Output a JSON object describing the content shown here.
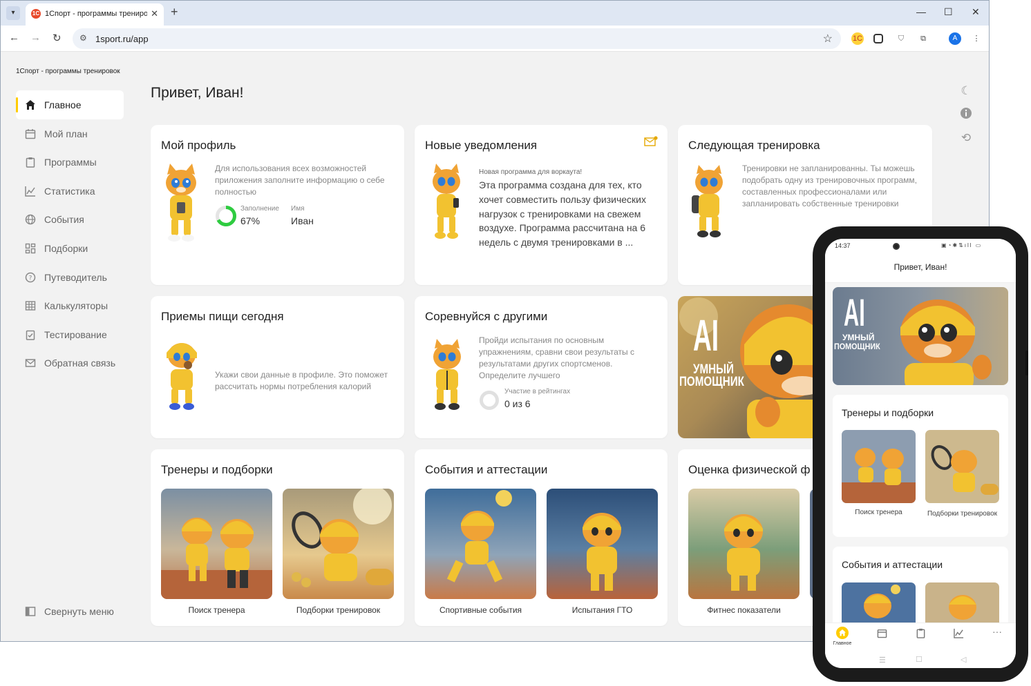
{
  "browser": {
    "tab_title": "1Спорт - программы трениро",
    "url": "1sport.ru/app",
    "favicon_text": "1С",
    "ext1_text": "1С",
    "avatar_letter": "A"
  },
  "app": {
    "title": "1Спорт - программы тренировок",
    "greeting": "Привет, Иван!",
    "collapse_label": "Свернуть меню"
  },
  "sidebar": {
    "items": [
      {
        "label": "Главное",
        "icon": "home-icon",
        "active": true
      },
      {
        "label": "Мой план",
        "icon": "calendar-icon"
      },
      {
        "label": "Программы",
        "icon": "clipboard-icon"
      },
      {
        "label": "Статистика",
        "icon": "chart-icon"
      },
      {
        "label": "События",
        "icon": "globe-icon"
      },
      {
        "label": "Подборки",
        "icon": "grid-icon"
      },
      {
        "label": "Путеводитель",
        "icon": "help-icon"
      },
      {
        "label": "Калькуляторы",
        "icon": "table-icon"
      },
      {
        "label": "Тестирование",
        "icon": "checklist-icon"
      },
      {
        "label": "Обратная связь",
        "icon": "mail-icon"
      }
    ]
  },
  "cards": {
    "profile": {
      "title": "Мой профиль",
      "text": "Для использования всех возможностей приложения заполните информацию о себе полностью",
      "fill_label": "Заполнение",
      "fill_value": "67%",
      "fill_fraction": 0.67,
      "name_label": "Имя",
      "name_value": "Иван"
    },
    "notifications": {
      "title": "Новые уведомления",
      "tag": "Новая программа для воркаута!",
      "text": "Эта программа создана для тех, кто хочет совместить пользу физических нагрузок с тренировками на свежем воздухе. Программа рассчитана на 6 недель с двумя тренировками в ..."
    },
    "next_training": {
      "title": "Следующая тренировка",
      "text": "Тренировки не запланированны. Ты можешь подобрать одну из тренировочных программ, составленных профессионалами или запланировать собственные тренировки"
    },
    "meals": {
      "title": "Приемы пищи сегодня",
      "text": "Укажи свои данные в профиле. Это поможет рассчитать нормы потребления калорий"
    },
    "compete": {
      "title": "Соревнуйся с другими",
      "text": "Пройди испытания по основным упражнениям, сравни свои результаты с результатами других спортсменов. Определите лучшего",
      "rating_label": "Участие в рейтингах",
      "rating_value": "0 из 6",
      "rating_fraction": 0
    },
    "ai_banner": {
      "big": "AI",
      "line1": "УМНЫЙ",
      "line2": "ПОМОЩНИК"
    },
    "trainers": {
      "title": "Тренеры и подборки",
      "items": [
        "Поиск тренера",
        "Подборки тренировок"
      ]
    },
    "events": {
      "title": "События и аттестации",
      "items": [
        "Спортивные события",
        "Испытания ГТО"
      ]
    },
    "fitness": {
      "title": "Оценка физической ф",
      "items": [
        "Фитнес показатели"
      ]
    }
  },
  "phone": {
    "time": "14:37",
    "greeting": "Привет, Иван!",
    "ai_big": "AI",
    "ai_line1": "УМНЫЙ",
    "ai_line2": "ПОМОЩНИК",
    "trainers_title": "Тренеры и подборки",
    "trainers_items": [
      "Поиск тренера",
      "Подборки тренировок"
    ],
    "events_title": "События и аттестации",
    "tabbar_home": "Главное"
  },
  "colors": {
    "accent": "#ffcc00",
    "progress_green": "#2ecc40",
    "mascot_yellow": "#f2c230"
  }
}
